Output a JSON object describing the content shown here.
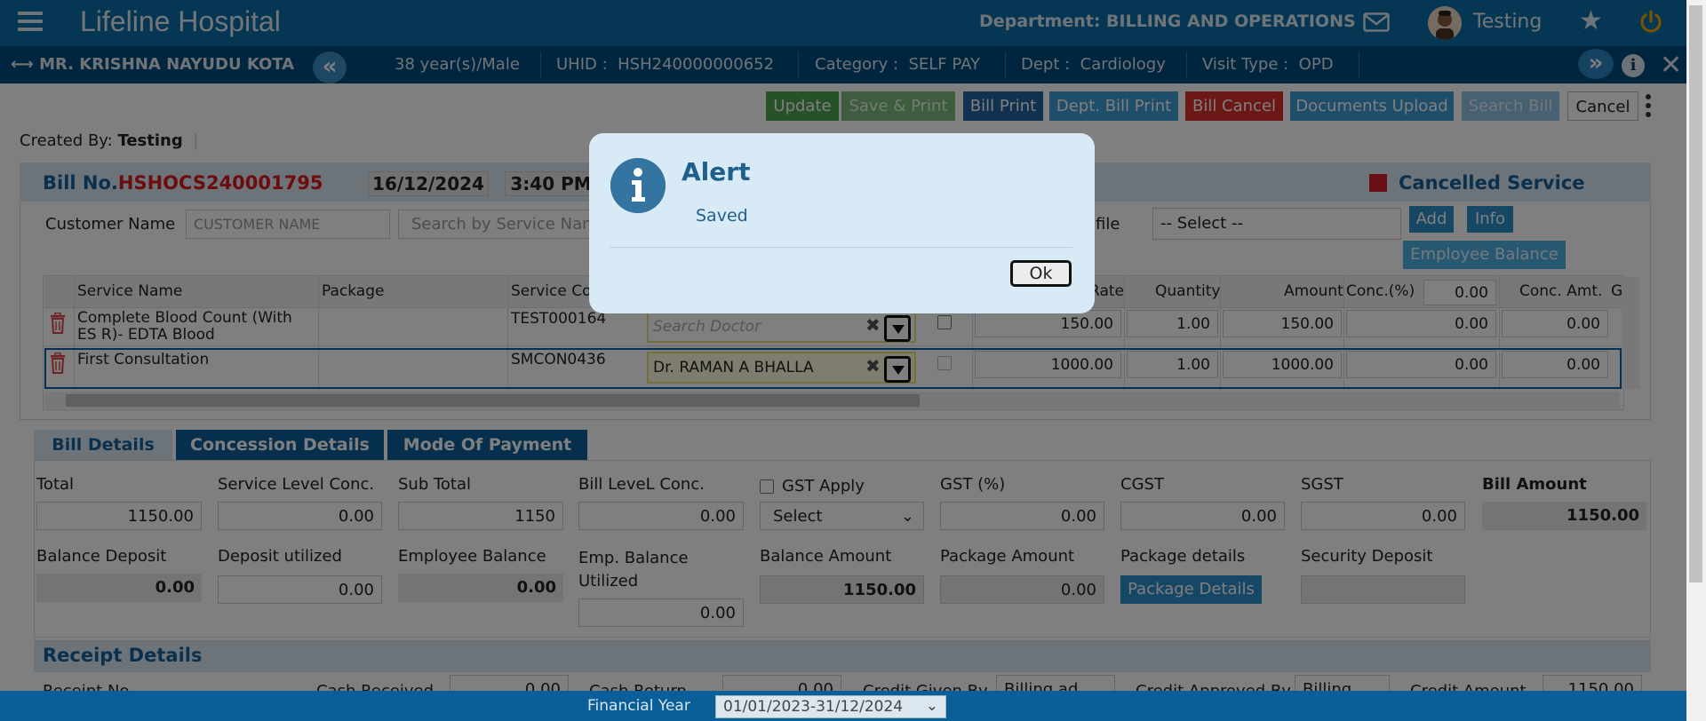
{
  "header": {
    "app_title": "Lifeline Hospital",
    "department_label": "Department: BILLING AND OPERATIONS",
    "user_name": "Testing"
  },
  "patient": {
    "name": "MR. KRISHNA NAYUDU KOTA",
    "age_gender": "38 year(s)/Male",
    "uhid_label": "UHID :",
    "uhid": "HSH240000000652",
    "category_label": "Category :",
    "category": "SELF PAY",
    "dept_label": "Dept :",
    "dept": "Cardiology",
    "visit_label": "Visit Type :",
    "visit_type": "OPD"
  },
  "toolbar": {
    "update": "Update",
    "save_print": "Save & Print",
    "bill_print": "Bill Print",
    "dept_bill_print": "Dept. Bill Print",
    "bill_cancel": "Bill Cancel",
    "documents_upload": "Documents Upload",
    "search_bill": "Search Bill",
    "cancel": "Cancel"
  },
  "created_by": {
    "label": "Created By:",
    "value": "Testing"
  },
  "bill": {
    "label": "Bill No.",
    "number": "HSHOCS240001795",
    "date": "16/12/2024",
    "time": "3:40 PM",
    "cancelled_service": "Cancelled Service",
    "customer_name_label": "Customer Name",
    "customer_name_placeholder": "CUSTOMER NAME",
    "service_search_placeholder": "Search by Service Name",
    "profile_label": "rofile",
    "profile_select": "-- Select --",
    "add": "Add",
    "info": "Info",
    "employee_balance": "Employee Balance"
  },
  "grid": {
    "headers": {
      "service_name": "Service Name",
      "package": "Package",
      "service_code": "Service Co",
      "rate": "Rate",
      "quantity": "Quantity",
      "amount": "Amount",
      "conc_pct": "Conc.(%)",
      "conc_pct_value": "0.00",
      "conc_amt": "Conc. Amt.",
      "extra": "G"
    },
    "rows": [
      {
        "service_name": "Complete Blood Count (With ES R)- EDTA Blood",
        "code": "TEST000164",
        "doctor_placeholder": "Search Doctor",
        "rate": "150.00",
        "quantity": "1.00",
        "amount": "150.00",
        "conc_pct": "0.00",
        "conc_amt": "0.00"
      },
      {
        "service_name": "First Consultation",
        "code": "SMCON0436",
        "doctor": "Dr. RAMAN A BHALLA",
        "rate": "1000.00",
        "quantity": "1.00",
        "amount": "1000.00",
        "conc_pct": "0.00",
        "conc_amt": "0.00"
      }
    ]
  },
  "tabs": {
    "bill_details": "Bill Details",
    "concession_details": "Concession Details",
    "mode_of_payment": "Mode Of Payment"
  },
  "details": {
    "total_label": "Total",
    "total": "1150.00",
    "service_conc_label": "Service Level Conc.",
    "service_conc": "0.00",
    "subtotal_label": "Sub Total",
    "subtotal": "1150",
    "bill_conc_label": "Bill LeveL Conc.",
    "bill_conc": "0.00",
    "gst_apply_label": "GST Apply",
    "gst_select": "Select",
    "gst_pct_label": "GST (%)",
    "gst_pct": "0.00",
    "cgst_label": "CGST",
    "cgst": "0.00",
    "sgst_label": "SGST",
    "sgst": "0.00",
    "bill_amount_label": "Bill Amount",
    "bill_amount": "1150.00",
    "balance_deposit_label": "Balance Deposit",
    "balance_deposit": "0.00",
    "deposit_utilized_label": "Deposit utilized",
    "deposit_utilized": "0.00",
    "employee_balance_label": "Employee Balance",
    "employee_balance": "0.00",
    "emp_balance_utilized_label_1": "Emp. Balance",
    "emp_balance_utilized_label_2": "Utilized",
    "emp_balance_utilized": "0.00",
    "balance_amount_label": "Balance Amount",
    "balance_amount": "1150.00",
    "package_amount_label": "Package Amount",
    "package_amount": "0.00",
    "package_details_label": "Package details",
    "package_details_button": "Package Details",
    "security_deposit_label": "Security Deposit",
    "security_deposit": ""
  },
  "receipt": {
    "title": "Receipt Details",
    "receipt_no_label": "Receipt No",
    "cash_received_label": "Cash Received",
    "cash_received": "0.00",
    "cash_return_label": "Cash Return",
    "cash_return": "0.00",
    "credit_given_by_label": "Credit Given By",
    "credit_given_by": "Billing ad",
    "credit_approved_by_label": "Credit Approved By",
    "credit_approved_by": "Billing",
    "credit_amount_label": "Credit Amount",
    "credit_amount": "1150.00"
  },
  "footer": {
    "financial_year_label": "Financial Year",
    "financial_year": "01/01/2023-31/12/2024"
  },
  "modal": {
    "title": "Alert",
    "message": "Saved",
    "ok": "Ok"
  },
  "colors": {
    "topbar": "#0a6fa8",
    "patientbar": "#004a7c",
    "bill_no": "#d8181e",
    "cancelled": "#d21f26",
    "modal_bg": "#d8eaf5"
  }
}
